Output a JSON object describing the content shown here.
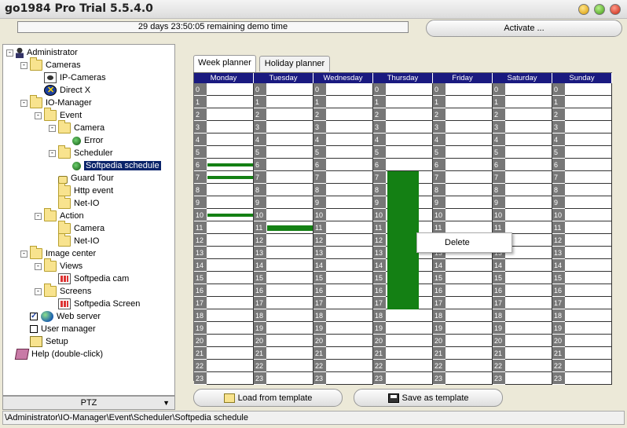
{
  "window": {
    "title": "go1984 Pro Trial 5.5.4.0"
  },
  "header": {
    "demo_text": "29 days 23:50:05 remaining demo time",
    "activate_label": "Activate ..."
  },
  "tree": [
    {
      "label": "Administrator",
      "icon": "user-icon",
      "level": 0,
      "exp": "-"
    },
    {
      "label": "Cameras",
      "icon": "folder-icon",
      "level": 1,
      "exp": "-"
    },
    {
      "label": "IP-Cameras",
      "icon": "camera-icon",
      "level": 2,
      "exp": ""
    },
    {
      "label": "Direct X",
      "icon": "directx-icon",
      "level": 2,
      "exp": ""
    },
    {
      "label": "IO-Manager",
      "icon": "folder-icon",
      "level": 1,
      "exp": "-"
    },
    {
      "label": "Event",
      "icon": "folder-icon",
      "level": 2,
      "exp": "-"
    },
    {
      "label": "Camera",
      "icon": "folder-icon",
      "level": 3,
      "exp": "-"
    },
    {
      "label": "Error",
      "icon": "event-icon",
      "level": 4,
      "exp": ""
    },
    {
      "label": "Scheduler",
      "icon": "folder-icon",
      "level": 3,
      "exp": "-"
    },
    {
      "label": "Softpedia schedule",
      "icon": "event-icon",
      "level": 4,
      "exp": "",
      "selected": true
    },
    {
      "label": "Guard Tour",
      "icon": "lock-icon",
      "level": 3,
      "exp": ""
    },
    {
      "label": "Http event",
      "icon": "folder-icon",
      "level": 3,
      "exp": ""
    },
    {
      "label": "Net-IO",
      "icon": "folder-icon",
      "level": 3,
      "exp": ""
    },
    {
      "label": "Action",
      "icon": "folder-icon",
      "level": 2,
      "exp": "-"
    },
    {
      "label": "Camera",
      "icon": "folder-icon",
      "level": 3,
      "exp": ""
    },
    {
      "label": "Net-IO",
      "icon": "folder-icon",
      "level": 3,
      "exp": ""
    },
    {
      "label": "Image center",
      "icon": "folder-icon",
      "level": 1,
      "exp": "-"
    },
    {
      "label": "Views",
      "icon": "folder-icon",
      "level": 2,
      "exp": "-"
    },
    {
      "label": "Softpedia cam",
      "icon": "screen-icon",
      "level": 3,
      "exp": ""
    },
    {
      "label": "Screens",
      "icon": "folder-icon",
      "level": 2,
      "exp": "-"
    },
    {
      "label": "Softpedia Screen",
      "icon": "screen-icon",
      "level": 3,
      "exp": ""
    },
    {
      "label": "Web server",
      "icon": "globe-icon",
      "level": 1,
      "exp": "",
      "checkbox": true
    },
    {
      "label": "User manager",
      "icon": "",
      "level": 1,
      "exp": "",
      "checkbox": false
    },
    {
      "label": "Setup",
      "icon": "setup-icon",
      "level": 1,
      "exp": ""
    },
    {
      "label": "Help (double-click)",
      "icon": "help-icon",
      "level": 0,
      "exp": ""
    }
  ],
  "ptz_label": "PTZ",
  "status_path": "\\Administrator\\IO-Manager\\Event\\Scheduler\\Softpedia schedule",
  "tabs": [
    {
      "label": "Week planner",
      "active": true
    },
    {
      "label": "Holiday planner",
      "active": false
    }
  ],
  "planner": {
    "days": [
      "Monday",
      "Tuesday",
      "Wednesday",
      "Thursday",
      "Friday",
      "Saturday",
      "Sunday"
    ],
    "hours": [
      "0",
      "1",
      "2",
      "3",
      "4",
      "5",
      "6",
      "7",
      "8",
      "9",
      "10",
      "11",
      "12",
      "13",
      "14",
      "15",
      "16",
      "17",
      "18",
      "19",
      "20",
      "21",
      "22",
      "23"
    ],
    "scheduled": [
      {
        "day": 0,
        "from": 6,
        "to": 6,
        "partial": "thin"
      },
      {
        "day": 0,
        "from": 7,
        "to": 7,
        "partial": "thin"
      },
      {
        "day": 0,
        "from": 10,
        "to": 10,
        "partial": "thin"
      },
      {
        "day": 1,
        "from": 11,
        "to": 11,
        "partial": "half"
      },
      {
        "day": 3,
        "from": 7,
        "to": 17,
        "partial": "full"
      }
    ],
    "block_color": "#148014"
  },
  "context_menu": {
    "delete_label": "Delete"
  },
  "buttons": {
    "load_label": "Load from template",
    "save_label": "Save as template"
  }
}
